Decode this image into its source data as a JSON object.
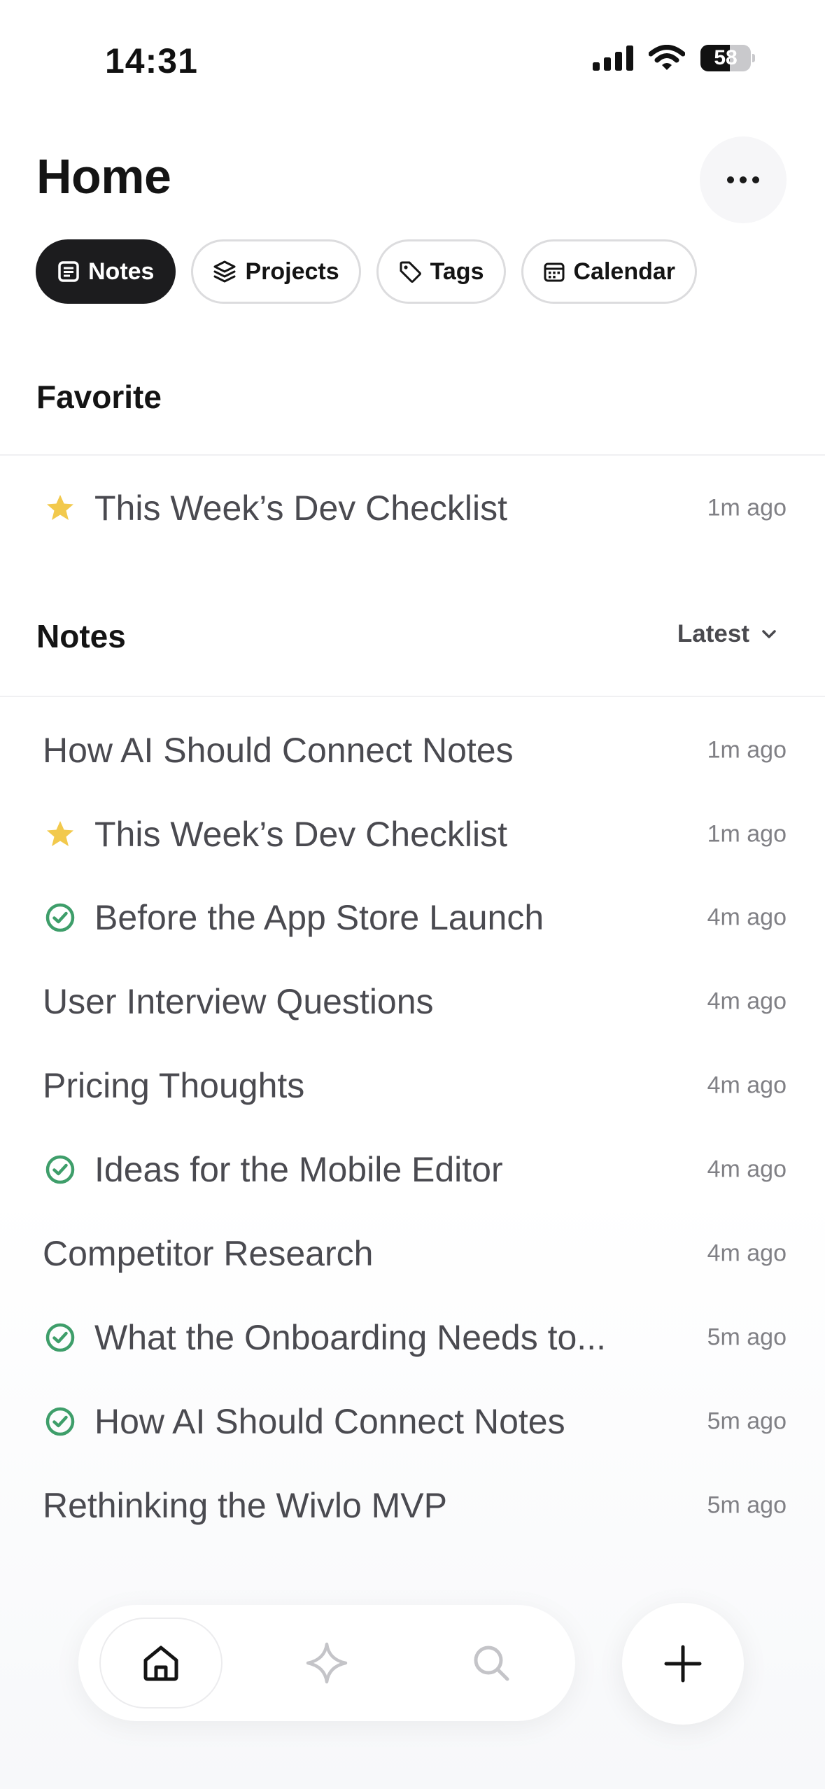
{
  "status_bar": {
    "time": "14:31",
    "battery_level": "58",
    "battery_fraction": 0.58
  },
  "header": {
    "title": "Home",
    "more_icon": "ellipsis-icon"
  },
  "tabs": [
    {
      "label": "Notes",
      "icon": "note-icon",
      "active": true
    },
    {
      "label": "Projects",
      "icon": "layers-icon",
      "active": false
    },
    {
      "label": "Tags",
      "icon": "tag-icon",
      "active": false
    },
    {
      "label": "Calendar",
      "icon": "calendar-icon",
      "active": false
    }
  ],
  "favorite": {
    "header": "Favorite",
    "items": [
      {
        "title": "This Week’s Dev Checklist",
        "time": "1m ago",
        "icon": "star-icon"
      }
    ]
  },
  "notes": {
    "header": "Notes",
    "sort_label": "Latest",
    "items": [
      {
        "title": "How AI Should Connect Notes",
        "time": "1m ago",
        "icon": ""
      },
      {
        "title": "This Week’s Dev Checklist",
        "time": "1m ago",
        "icon": "star-icon"
      },
      {
        "title": "Before the App Store Launch",
        "time": "4m ago",
        "icon": "check-circle-icon"
      },
      {
        "title": "User Interview Questions",
        "time": "4m ago",
        "icon": ""
      },
      {
        "title": "Pricing Thoughts",
        "time": "4m ago",
        "icon": ""
      },
      {
        "title": "Ideas for the Mobile Editor",
        "time": "4m ago",
        "icon": "check-circle-icon"
      },
      {
        "title": "Competitor Research",
        "time": "4m ago",
        "icon": ""
      },
      {
        "title": "What the Onboarding Needs to...",
        "time": "5m ago",
        "icon": "check-circle-icon"
      },
      {
        "title": "How AI Should Connect Notes",
        "time": "5m ago",
        "icon": "check-circle-icon"
      },
      {
        "title": "Rethinking the Wivlo MVP",
        "time": "5m ago",
        "icon": ""
      }
    ]
  },
  "bottom_nav": [
    {
      "icon": "home-icon",
      "active": true
    },
    {
      "icon": "sparkle-icon",
      "active": false
    },
    {
      "icon": "search-icon",
      "active": false
    }
  ],
  "fab": {
    "icon": "plus-icon"
  },
  "colors": {
    "star": "#F2C94C",
    "check": "#3E9E6A",
    "active_tab_bg": "#1C1C1E",
    "text_primary": "#141414",
    "text_secondary": "#4A4A50",
    "text_muted": "#808085"
  }
}
